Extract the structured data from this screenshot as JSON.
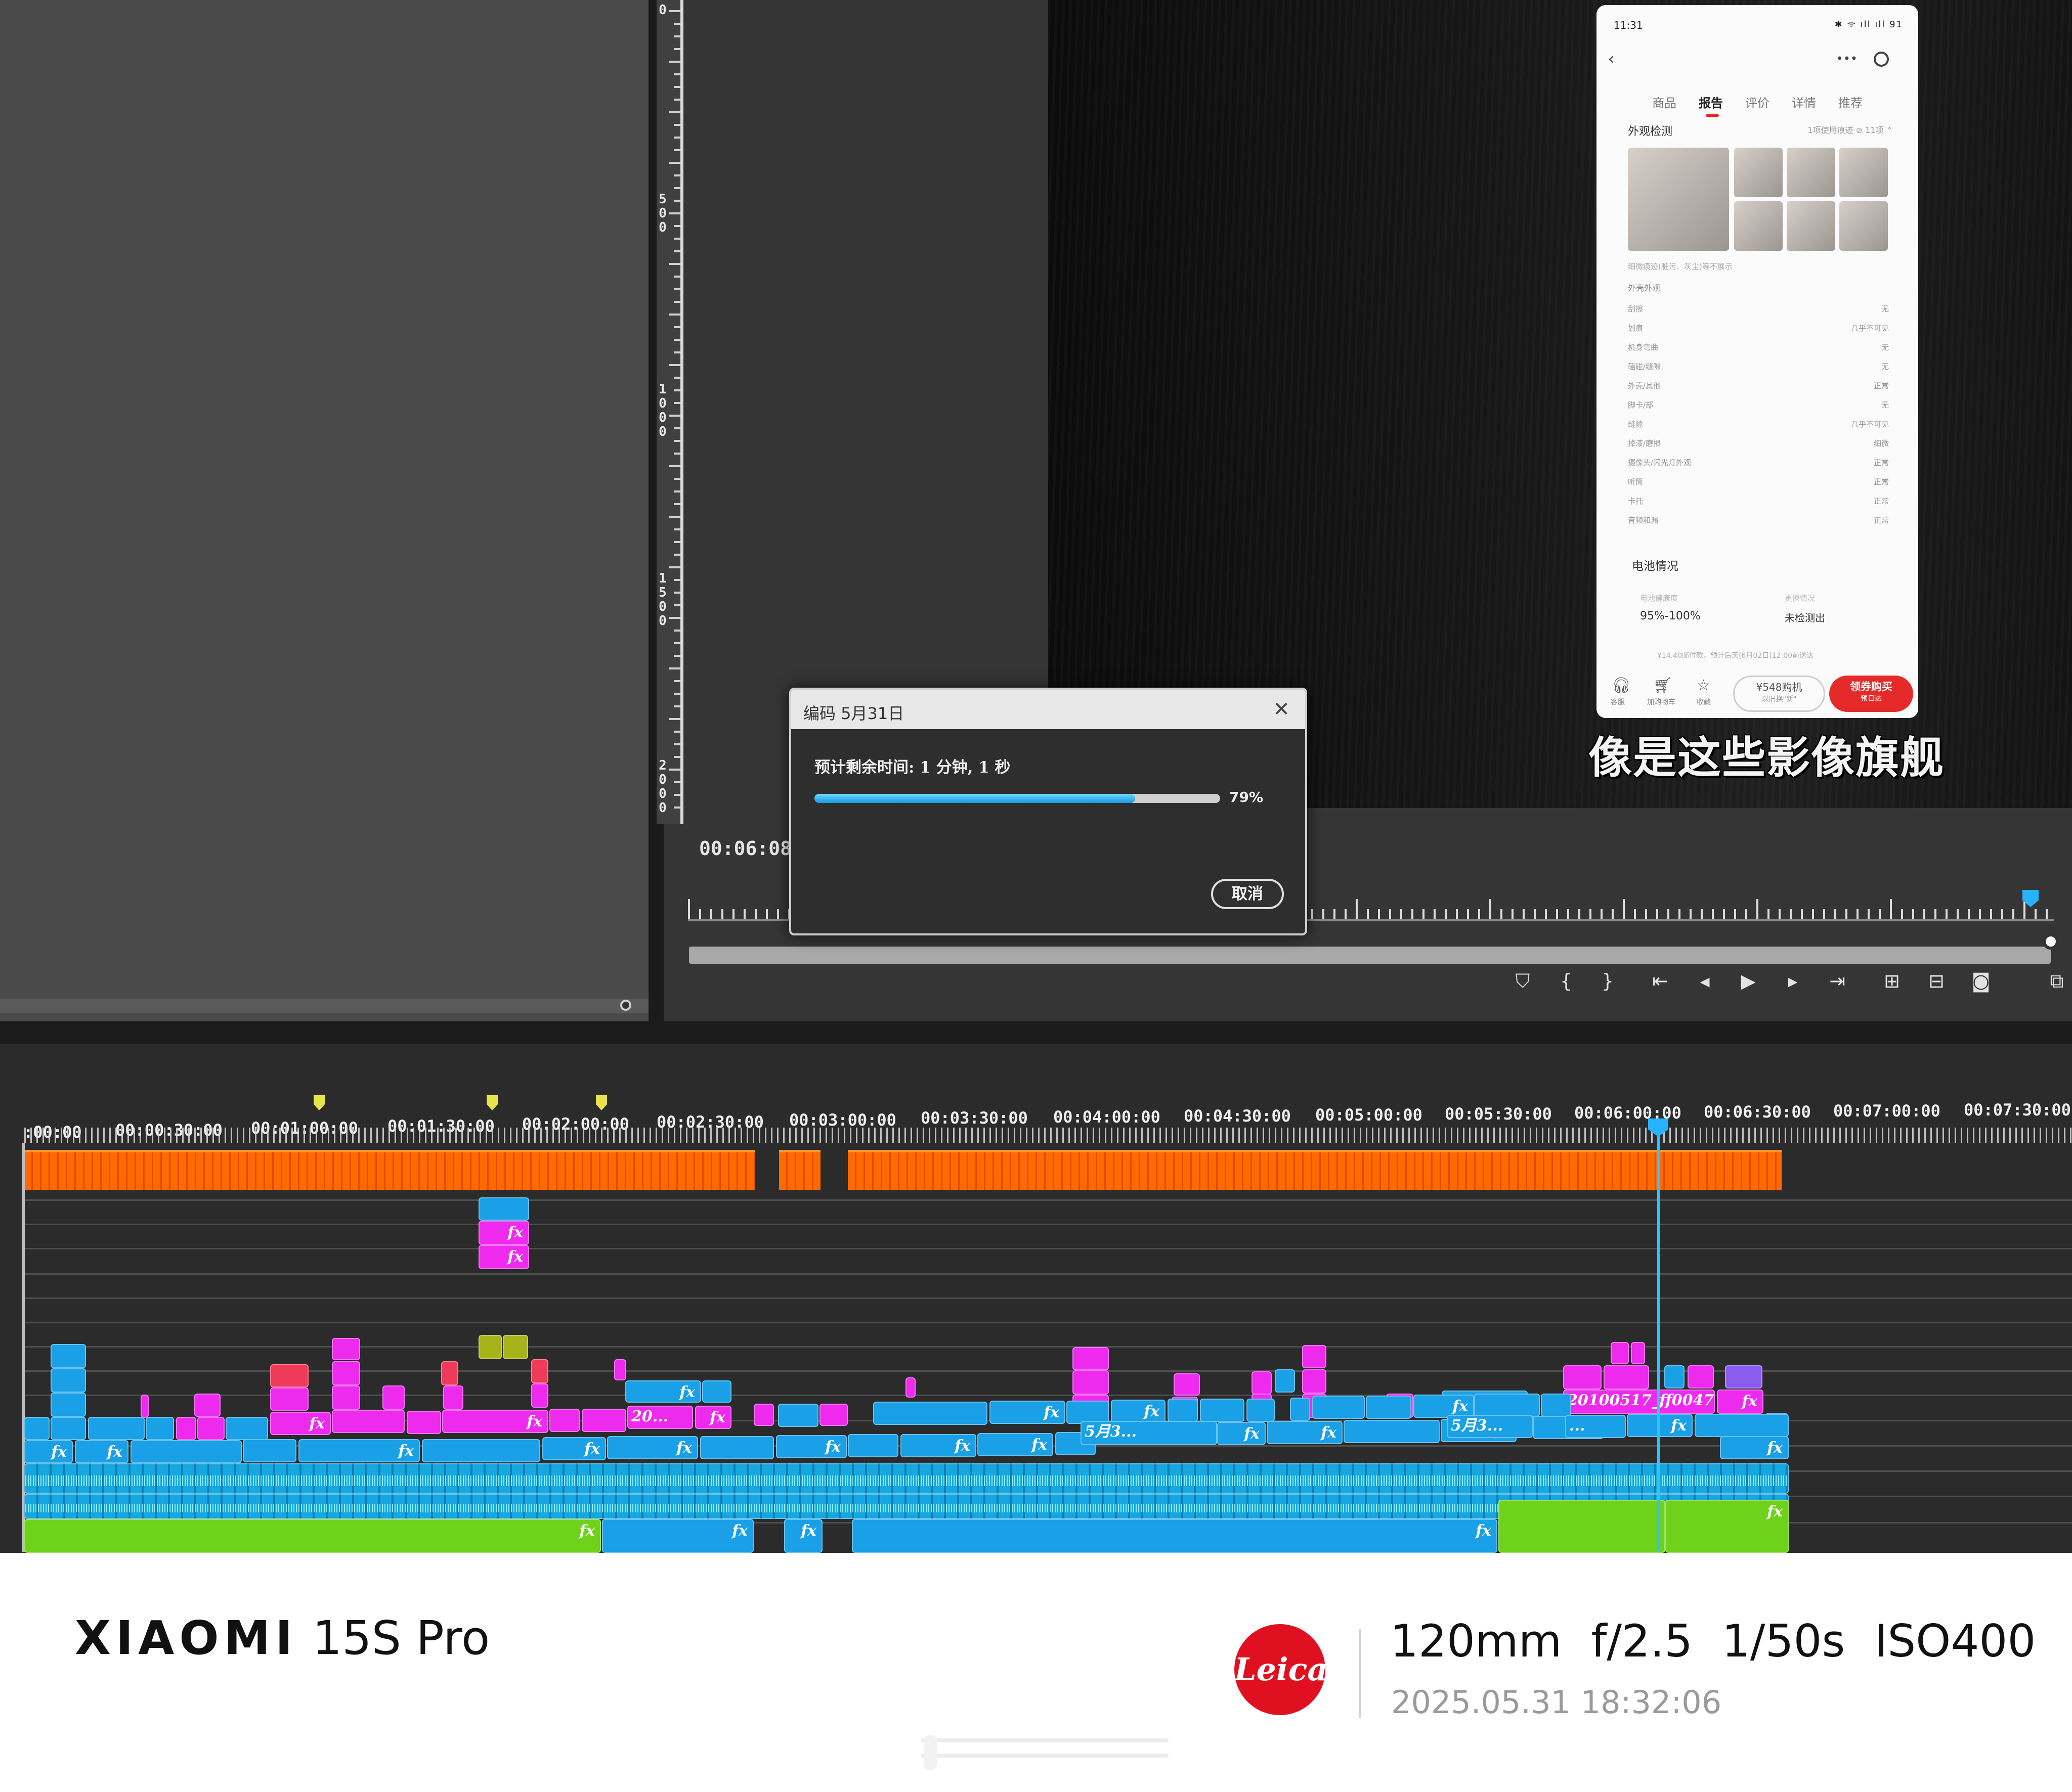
{
  "ruler_vertical": [
    "0",
    "500",
    "1000",
    "1500",
    "2000"
  ],
  "monitor": {
    "timecode": "00:06:08:",
    "subtitle": "像是这些影像旗舰"
  },
  "phone": {
    "time": "11:31",
    "status": "✱ ᯤ ıll ıll 91",
    "tabs": [
      "商品",
      "报告",
      "评价",
      "详情",
      "推荐"
    ],
    "active_tab": "报告",
    "section_title": "外观检测",
    "section_meta": "1项使用痕迹 ⊘ 11项 ⌃",
    "note": "细微痕迹(脏污、灰尘)等不展示",
    "sub_title": "外壳外观",
    "rows": [
      {
        "label": "刮擦",
        "value": "无"
      },
      {
        "label": "划痕",
        "value": "几乎不可见"
      },
      {
        "label": "机身弯曲",
        "value": "无"
      },
      {
        "label": "磕碰/缝隙",
        "value": "无"
      },
      {
        "label": "外壳/其他",
        "value": "正常"
      },
      {
        "label": "脚卡/部",
        "value": "无"
      },
      {
        "label": "缝隙",
        "value": "几乎不可见"
      },
      {
        "label": "掉漆/磨损",
        "value": "细微"
      },
      {
        "label": "摄像头/闪光灯外观",
        "value": "正常"
      },
      {
        "label": "听筒",
        "value": "正常"
      },
      {
        "label": "卡托",
        "value": "正常"
      },
      {
        "label": "音频和漏",
        "value": "正常"
      }
    ],
    "battery_title": "电池情况",
    "battery_health_label": "电池健康度",
    "battery_health_value": "95%-100%",
    "battery_cycle_label": "更换情况",
    "battery_cycle_value": "未检测出",
    "battery_note": "¥14.40邮付款，预计后天(6月02日)12:00前送达",
    "bottom_icons": [
      {
        "icon": "headset-icon",
        "label": "客服"
      },
      {
        "icon": "cart-icon",
        "label": "加购物车"
      },
      {
        "icon": "star-icon",
        "label": "收藏"
      }
    ],
    "price_button": "¥548购机",
    "price_sub": "以旧换\"新\"",
    "buy_button": "领券购买",
    "buy_sub": "预日达"
  },
  "dialog": {
    "title": "编码 5月31日",
    "remaining": "预计剩余时间: 1 分钟, 1 秒",
    "progress": 0.79,
    "percent_label": "79%",
    "cancel_label": "取消"
  },
  "timeline": {
    "ruler_labels": [
      ":00:00",
      "00:00:30:00",
      "00:01:00:00",
      "00:01:30:00",
      "00:02:00:00",
      "00:02:30:00",
      "00:03:00:00",
      "00:03:30:00",
      "00:04:00:00",
      "00:04:30:00",
      "00:05:00:00",
      "00:05:30:00",
      "00:06:00:00",
      "00:06:30:00",
      "00:07:00:00",
      "00:07:30:00"
    ],
    "clip_labels": {
      "clip_a": "20...",
      "clip_b": "5月3...",
      "clip_c": "5月3...",
      "clip_d": "20100517_ff0047...",
      "clip_e": "...",
      "fx": "fx"
    }
  },
  "footer": {
    "brand": "XIAOMI",
    "model": " 15S Pro",
    "leica": "Leica",
    "specs": "120mm f/2.5 1/50s ISO400",
    "datetime": "2025.05.31 18:32:06"
  }
}
